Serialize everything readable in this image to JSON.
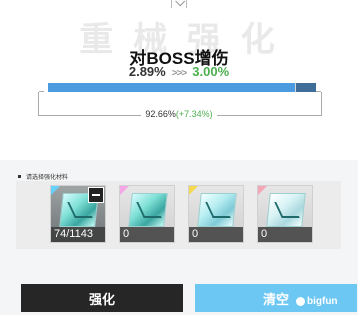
{
  "header": {
    "watermark": "重 械 强 化",
    "stat_title": "对BOSS增伤",
    "stat_old": "2.89%",
    "stat_arrow": ">>>",
    "stat_new": "3.00%",
    "bar_progress": 0.92,
    "progress_label": "92.66%",
    "progress_increase": "(+7.34%)"
  },
  "materials": {
    "title": "请选择强化材料",
    "items": [
      {
        "count": "74/1143",
        "corner_color": "#66d3ff",
        "selected": true
      },
      {
        "count": "0",
        "corner_color": "#f4a6e6",
        "selected": false
      },
      {
        "count": "0",
        "corner_color": "#f5d84f",
        "selected": false
      },
      {
        "count": "0",
        "corner_color": "#f4a6b6",
        "selected": false
      }
    ]
  },
  "buttons": {
    "enhance": "强化",
    "clear": "清空"
  },
  "logo": "bigfun"
}
